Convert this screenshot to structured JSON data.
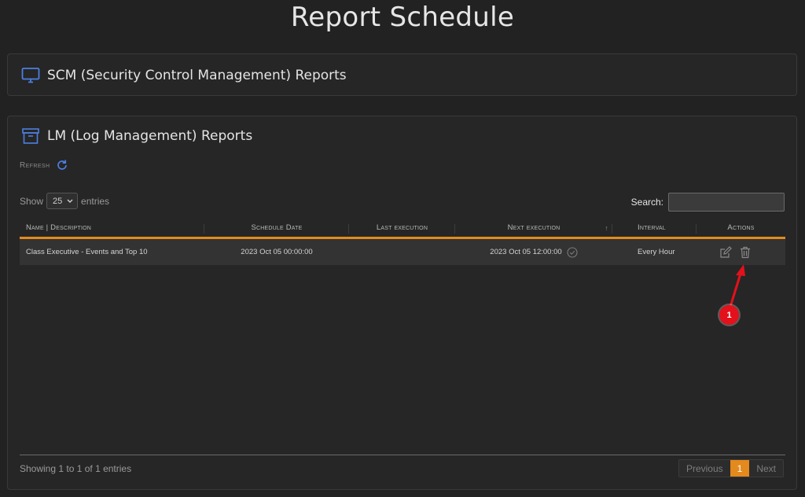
{
  "page": {
    "title": "Report Schedule"
  },
  "scm_panel": {
    "title": "SCM (Security Control Management) Reports",
    "icon": "monitor-icon"
  },
  "lm_panel": {
    "title": "LM (Log Management) Reports",
    "icon": "archive-box-icon"
  },
  "toolbar": {
    "refresh_label": "Refresh",
    "refresh_icon": "refresh-icon"
  },
  "length_menu": {
    "show_label": "Show",
    "value": "25",
    "entries_label": "entries"
  },
  "search": {
    "label": "Search:",
    "value": ""
  },
  "table": {
    "columns": [
      "Name | Description",
      "Schedule Date",
      "Last execution",
      "Next execution",
      "Interval",
      "Actions"
    ],
    "sorted_column_indicator": "↑",
    "rows": [
      {
        "name": "Class Executive - Events and Top 10",
        "schedule_date": "2023 Oct 05 00:00:00",
        "last_execution": "",
        "next_execution": "2023 Oct 05 12:00:00",
        "interval": "Every Hour",
        "actions": [
          "edit-icon",
          "trash-icon"
        ]
      }
    ]
  },
  "footer": {
    "info": "Showing 1 to 1 of 1 entries"
  },
  "pagination": {
    "previous": "Previous",
    "current": "1",
    "next": "Next"
  },
  "annotation": {
    "badge": "1"
  },
  "colors": {
    "accent": "#e3891d",
    "icon_blue": "#4d7fe0",
    "annotation_red": "#e3111b"
  }
}
